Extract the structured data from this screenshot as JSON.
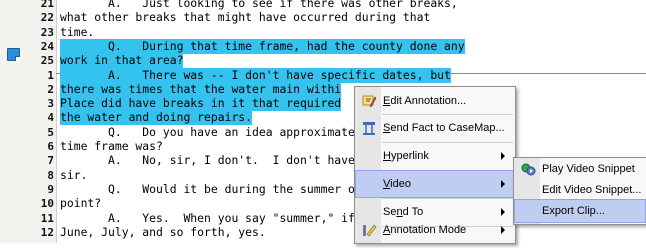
{
  "transcript": {
    "lines": [
      {
        "num": "21",
        "text": "       A.   Just looking to see if there was other breaks,",
        "highlight": false
      },
      {
        "num": "22",
        "text": "what other breaks that might have occurred during that",
        "highlight": false
      },
      {
        "num": "23",
        "text": "time.",
        "highlight": false
      },
      {
        "num": "24",
        "text": "       Q.   During that time frame, had the county done any",
        "highlight": true
      },
      {
        "num": "25",
        "text": "work in that area?",
        "highlight": true
      },
      {
        "num": "1",
        "text": "       A.   There was -- I don't have specific dates, but",
        "highlight": true
      },
      {
        "num": "2",
        "text": "there was times that the water main withi",
        "highlight": true
      },
      {
        "num": "3",
        "text": "Place did have breaks in it that required",
        "highlight": true
      },
      {
        "num": "4",
        "text": "the water and doing repairs.",
        "highlight": true
      },
      {
        "num": "5",
        "text": "       Q.   Do you have an idea approximate",
        "highlight": false
      },
      {
        "num": "6",
        "text": "time frame was?",
        "highlight": false
      },
      {
        "num": "7",
        "text": "       A.   No, sir, I don't.  I don't have",
        "highlight": false
      },
      {
        "num": "8",
        "text": "sir.",
        "highlight": false
      },
      {
        "num": "9",
        "text": "       Q.   Would it be during the summer o",
        "highlight": false
      },
      {
        "num": "10",
        "text": "point?",
        "highlight": false
      },
      {
        "num": "11",
        "text": "       A.   Yes.  When you say \"summer,\" if",
        "highlight": false
      },
      {
        "num": "12",
        "text": "June, July, and so forth, yes.",
        "highlight": false
      }
    ]
  },
  "context_menu": {
    "items": [
      {
        "label": "Edit Annotation...",
        "mnemonic": "E",
        "rest": "dit Annotation...",
        "icon": "edit-annotation-icon",
        "submenu": false
      },
      {
        "label": "Send Fact to CaseMap...",
        "mnemonic": "S",
        "rest": "end Fact to CaseMap...",
        "icon": "casemap-icon",
        "submenu": false
      },
      {
        "label": "Hyperlink",
        "mnemonic": "H",
        "rest": "yperlink",
        "icon": "",
        "submenu": true
      },
      {
        "label": "Video",
        "mnemonic": "V",
        "rest": "ideo",
        "icon": "",
        "submenu": true,
        "selected": true
      },
      {
        "label": "Send To",
        "mnemonic": "",
        "rest": "Send To",
        "icon": "",
        "submenu": true
      },
      {
        "label": "Annotation Mode",
        "mnemonic": "A",
        "rest": "nnotation Mode",
        "icon": "annotation-mode-icon",
        "submenu": true
      }
    ]
  },
  "video_submenu": {
    "items": [
      {
        "label": "Play Video Snippet",
        "icon": "play-video-icon"
      },
      {
        "label": "Edit Video Snippet...",
        "icon": ""
      },
      {
        "label": "Export Clip...",
        "icon": "",
        "selected": true
      }
    ]
  },
  "colors": {
    "highlight": "#33c3ee",
    "menu_selection": "#bfcdf3",
    "annotation_flag": "#2f8bd6"
  }
}
